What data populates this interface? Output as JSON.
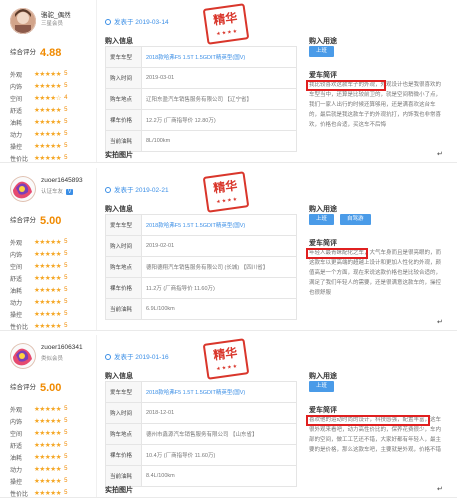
{
  "reviews": [
    {
      "user": {
        "name": "骆驼_偶然",
        "tag": "三星会员",
        "badge": ""
      },
      "overall_label": "综合评分",
      "overall_score": "4.88",
      "ratings": [
        {
          "label": "外观",
          "stars": "★★★★★",
          "value": "5"
        },
        {
          "label": "内饰",
          "stars": "★★★★★",
          "value": "5"
        },
        {
          "label": "空间",
          "stars": "★★★★☆",
          "value": "4"
        },
        {
          "label": "舒适",
          "stars": "★★★★★",
          "value": "5"
        },
        {
          "label": "油耗",
          "stars": "★★★★★",
          "value": "5"
        },
        {
          "label": "动力",
          "stars": "★★★★★",
          "value": "5"
        },
        {
          "label": "操控",
          "stars": "★★★★★",
          "value": "5"
        },
        {
          "label": "性价比",
          "stars": "★★★★★",
          "value": "5"
        }
      ],
      "date": "发表于  2019-03-14",
      "stamp": {
        "text": "精华",
        "sub": "★★★★"
      },
      "info_title": "购入信息",
      "info": [
        {
          "k": "爱车车型",
          "v": "2018款哈弗F5 1.5T 1.5GDIT精英型(国V)",
          "link": true
        },
        {
          "k": "购入时间",
          "v": "2019-03-01",
          "link": false
        },
        {
          "k": "购车地点",
          "v": "辽阳东盈汽车销售服务有限公司 【辽宁省】",
          "link": false
        },
        {
          "k": "裸车价格",
          "v": "12.2万 (厂商指导价 12.80万)",
          "link": false
        },
        {
          "k": "当前油耗",
          "v": "8L/100km",
          "link": false
        }
      ],
      "purpose_title": "购入用途",
      "purposes": [
        "上班"
      ],
      "eval_title": "爱车简评",
      "eval_text": "我比较喜欢这款车子的外观，外观设计也是我很喜欢的车型当中，还算是比较前卫的，就是空间稍微小了点，我们一家人出行的时候还算够用，还是满喜欢这台车的，最后就是我这款车子的外观抗打，内饰我也非常喜欢，价格也合适，买这车不后悔",
      "photo_title": "实拍图片"
    },
    {
      "user": {
        "name": "zuoer1645893",
        "tag": "认证车友",
        "badge": "V"
      },
      "overall_label": "综合评分",
      "overall_score": "5.00",
      "ratings": [
        {
          "label": "外观",
          "stars": "★★★★★",
          "value": "5"
        },
        {
          "label": "内饰",
          "stars": "★★★★★",
          "value": "5"
        },
        {
          "label": "空间",
          "stars": "★★★★★",
          "value": "5"
        },
        {
          "label": "舒适",
          "stars": "★★★★★",
          "value": "5"
        },
        {
          "label": "油耗",
          "stars": "★★★★★",
          "value": "5"
        },
        {
          "label": "动力",
          "stars": "★★★★★",
          "value": "5"
        },
        {
          "label": "操控",
          "stars": "★★★★★",
          "value": "5"
        },
        {
          "label": "性价比",
          "stars": "★★★★★",
          "value": "5"
        }
      ],
      "date": "发表于  2019-02-21",
      "stamp": {
        "text": "精华",
        "sub": "★★★★"
      },
      "info_title": "购入信息",
      "info": [
        {
          "k": "爱车车型",
          "v": "2018款哈弗F5 1.5T 1.5GDIT精英型(国V)",
          "link": true
        },
        {
          "k": "购入时间",
          "v": "2019-02-01",
          "link": false
        },
        {
          "k": "购车地点",
          "v": "德阳德翔汽车销售服务有限公司 (长城) 【四川省】",
          "link": false
        },
        {
          "k": "裸车价格",
          "v": "11.2万 (厂商指导价 11.60万)",
          "link": false
        },
        {
          "k": "当前油耗",
          "v": "6.9L/100km",
          "link": false
        }
      ],
      "purpose_title": "购入用途",
      "purposes": [
        "上班",
        "自驾游"
      ],
      "eval_title": "爱车简评",
      "eval_text": "年轻人最青睐配化之车，大气车身而且是很亮眼的，而这款车以更高端的超越上设计和更加人性化的外观，颜值高是一个方面，现在来说这款价格也是比较合适的，满足了我们年轻人的需要，还是很满意这款车的，操控也很舒服",
      "photo_title": ""
    },
    {
      "user": {
        "name": "zuoer1606341",
        "tag": "类似会员",
        "badge": ""
      },
      "overall_label": "综合评分",
      "overall_score": "5.00",
      "ratings": [
        {
          "label": "外观",
          "stars": "★★★★★",
          "value": "5"
        },
        {
          "label": "内饰",
          "stars": "★★★★★",
          "value": "5"
        },
        {
          "label": "空间",
          "stars": "★★★★★",
          "value": "5"
        },
        {
          "label": "舒适",
          "stars": "★★★★★",
          "value": "5"
        },
        {
          "label": "油耗",
          "stars": "★★★★★",
          "value": "5"
        },
        {
          "label": "动力",
          "stars": "★★★★★",
          "value": "5"
        },
        {
          "label": "操控",
          "stars": "★★★★★",
          "value": "5"
        },
        {
          "label": "性价比",
          "stars": "★★★★★",
          "value": "5"
        }
      ],
      "date": "发表于  2019-01-16",
      "stamp": {
        "text": "精华",
        "sub": "★★★★"
      },
      "info_title": "购入信息",
      "info": [
        {
          "k": "爱车车型",
          "v": "2018款哈弗F5 1.5T 1.5GDIT精英型(国V)",
          "link": true
        },
        {
          "k": "购入时间",
          "v": "2018-12-01",
          "link": false
        },
        {
          "k": "购车地点",
          "v": "德州市鑫源汽车销售服务有限公司 【山东省】",
          "link": false
        },
        {
          "k": "裸车价格",
          "v": "10.4万 (厂商指导价 11.60万)",
          "link": false
        },
        {
          "k": "当前油耗",
          "v": "8.4L/100km",
          "link": false
        }
      ],
      "purpose_title": "购入用途",
      "purposes": [
        "上班"
      ],
      "eval_title": "爱车简评",
      "eval_text": "喜欢他的运动时尚的设计，科技感强，配置丰富，这车很外观来看吧，动力高性价比的，保养花费很少，车内部的空间，做工工艺还不错，大家好都有年轻人，最主要的是价格，那么这款车吧，主要就是外观，价格不错",
      "photo_title": "实拍图片"
    }
  ],
  "enter_symbol": "↵"
}
